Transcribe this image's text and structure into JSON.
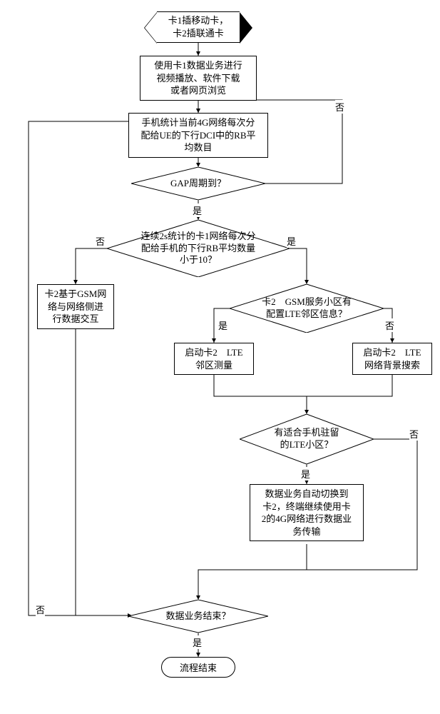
{
  "start": "卡1插移动卡，\n卡2插联通卡",
  "step1": "使用卡1数据业务进行\n视频播放、软件下载\n或者网页浏览",
  "step2": "手机统计当前4G网络每次分\n配给UE的下行DCI中的RB平\n均数目",
  "dec_gap": "GAP周期到？",
  "dec_rb": "连续2s统计的卡1网络每次分\n配给手机的下行RB平均数量\n小于10？",
  "left_box": "卡2基于GSM网\n络与网络侧进\n行数据交互",
  "dec_cfg": "卡2　GSM服务小区有\n配置LTE邻区信息？",
  "box_meas": "启动卡2　LTE\n邻区测量",
  "box_bg": "启动卡2　LTE\n网络背景搜索",
  "dec_fit": "有适合手机驻留\n的LTE小区？",
  "box_switch": "数据业务自动切换到\n卡2，终端继续使用卡\n2的4G网络进行数据业\n务传输",
  "dec_end": "数据业务结束？",
  "end": "流程结束",
  "yes": "是",
  "no": "否"
}
